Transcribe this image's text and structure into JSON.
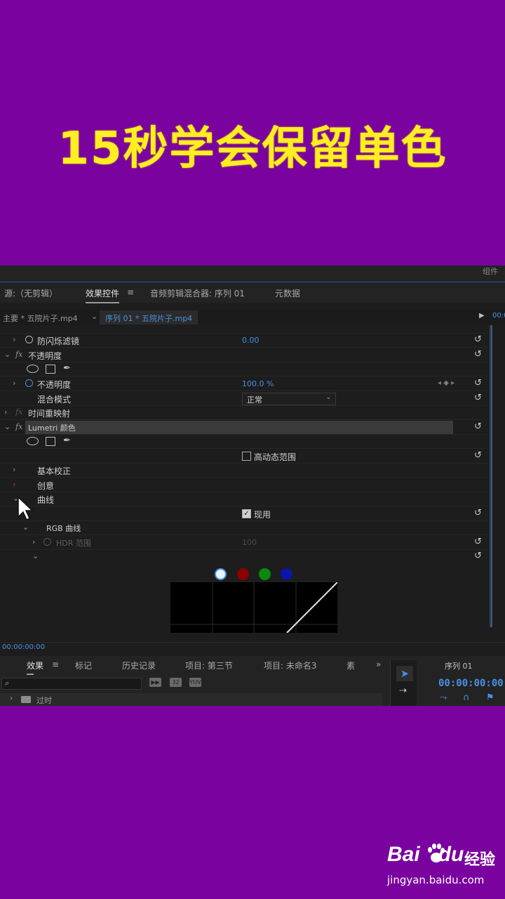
{
  "banner": {
    "title": "15秒学会保留单色"
  },
  "header": {
    "corner_text": "组件"
  },
  "panel_tabs": [
    {
      "label": "源:（无剪辑）"
    },
    {
      "label": "效果控件"
    },
    {
      "label": "≡"
    },
    {
      "label": "音频剪辑混合器: 序列 01"
    },
    {
      "label": "元数据"
    }
  ],
  "clip_bar": {
    "source": "主要 * 五院片子.mp4",
    "sequence": "序列 01 * 五院片子.mp4",
    "timecode": "00:0"
  },
  "properties": {
    "flicker_filter": {
      "label": "防闪烁滤镜",
      "value": "0.00"
    },
    "opacity_group": {
      "label": "不透明度"
    },
    "opacity": {
      "label": "不透明度",
      "value": "100.0 %"
    },
    "blend_mode": {
      "label": "混合模式",
      "value": "正常"
    },
    "time_remap": {
      "label": "时间重映射"
    },
    "lumetri": {
      "label": "Lumetri 颜色"
    },
    "hdr_checkbox": {
      "label": "高动态范围",
      "checked": false
    },
    "basic_correction": {
      "label": "基本校正"
    },
    "creative": {
      "label": "创意"
    },
    "curves": {
      "label": "曲线"
    },
    "enable_checkbox": {
      "label": "现用",
      "checked": true
    },
    "rgb_curves": {
      "label": "RGB 曲线"
    },
    "hdr_range": {
      "label": "HDR 范围",
      "value": "100"
    }
  },
  "curve_channels": [
    {
      "name": "white",
      "color": "#e8f4ff"
    },
    {
      "name": "red",
      "color": "#8b0000"
    },
    {
      "name": "green",
      "color": "#0a8a0a"
    },
    {
      "name": "blue",
      "color": "#0a16a8"
    }
  ],
  "timebar": {
    "timecode": "00:00:00:00"
  },
  "bottom_tabs": [
    {
      "label": "效果"
    },
    {
      "label": "≡"
    },
    {
      "label": "标记"
    },
    {
      "label": "历史记录"
    },
    {
      "label": "项目: 第三节"
    },
    {
      "label": "项目: 未命名3"
    },
    {
      "label": "素"
    },
    {
      "label": "»"
    }
  ],
  "effects_panel": {
    "search_icon": "⌕",
    "list_item": "过时",
    "tool_buttons": [
      "▶▶",
      "32",
      "YUV"
    ]
  },
  "sequence_panel": {
    "name": "序列 01",
    "timecode": "00:00:00:00"
  },
  "watermark": {
    "brand": "Bai",
    "brand_end": "du",
    "cn": "经验",
    "url": "jingyan.baidu.com"
  },
  "colors": {
    "accent": "#4a90e2",
    "banner_bg": "#7a029e",
    "title": "#ffee22"
  }
}
